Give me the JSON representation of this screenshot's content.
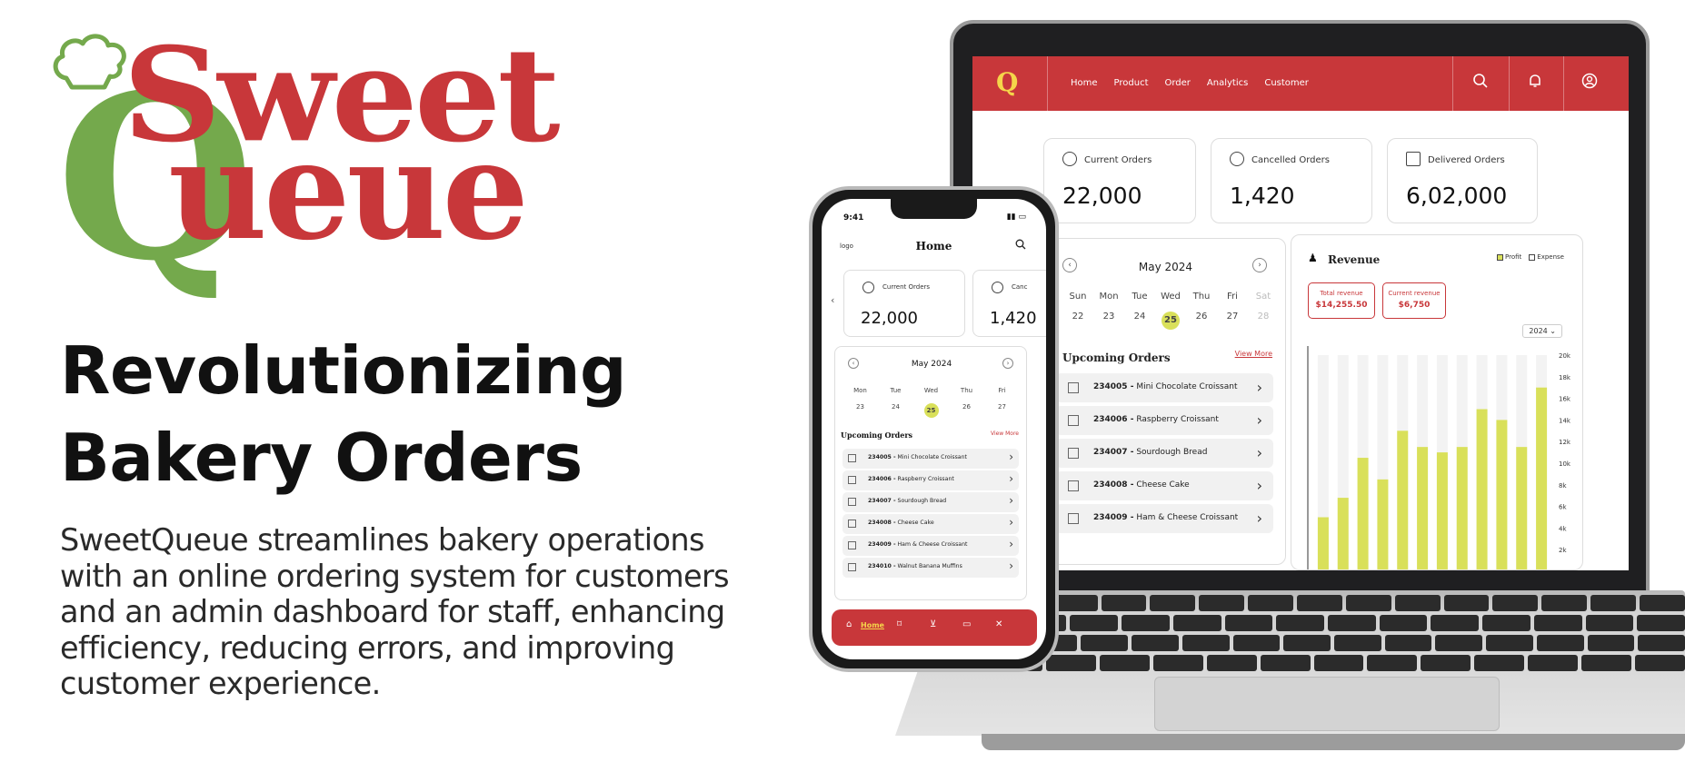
{
  "brand": {
    "name_line1": "Sweet",
    "name_line2": "ueue",
    "big_q": "Q",
    "colors": {
      "red": "#c8373a",
      "green": "#74a94c",
      "yellow": "#d9e05a"
    }
  },
  "hero": {
    "headline_1": "Revolutionizing",
    "headline_2": "Bakery Orders",
    "description": "SweetQueue streamlines bakery operations with an online ordering system for customers and an admin dashboard for staff, enhancing efficiency, reducing errors, and improving customer experience."
  },
  "laptop": {
    "nav": {
      "logo": "Q",
      "links": [
        "Home",
        "Product",
        "Order",
        "Analytics",
        "Customer"
      ],
      "icons": [
        "search-icon",
        "bell-icon",
        "user-icon"
      ]
    },
    "cards": [
      {
        "label": "Current Orders",
        "value": "22,000",
        "icon": "clock-icon"
      },
      {
        "label": "Cancelled Orders",
        "value": "1,420",
        "icon": "cancel-icon"
      },
      {
        "label": "Delivered Orders",
        "value": "6,02,000",
        "icon": "receipt-icon"
      }
    ],
    "calendar": {
      "month": "May 2024",
      "days": [
        "Sun",
        "Mon",
        "Tue",
        "Wed",
        "Thu",
        "Fri",
        "Sat"
      ],
      "dates": [
        "22",
        "23",
        "24",
        "25",
        "26",
        "27",
        "28"
      ],
      "selected": "25"
    },
    "upcoming": {
      "title": "Upcoming Orders",
      "view_more": "View More",
      "orders": [
        {
          "id": "234005 -",
          "item": "Mini Chocolate Croissant"
        },
        {
          "id": "234006 -",
          "item": "Raspberry Croissant"
        },
        {
          "id": "234007 -",
          "item": "Sourdough Bread"
        },
        {
          "id": "234008 -",
          "item": "Cheese Cake"
        },
        {
          "id": "234009 -",
          "item": "Ham & Cheese Croissant"
        }
      ]
    },
    "revenue": {
      "title": "Revenue",
      "legend_profit": "Profit",
      "legend_expense": "Expense",
      "total_label": "Total revenue",
      "total_value": "$14,255.50",
      "current_label": "Current revenue",
      "current_value": "$6,750",
      "year": "2024"
    }
  },
  "phone": {
    "time": "9:41",
    "logo": "logo",
    "title": "Home",
    "cards": [
      {
        "label": "Current Orders",
        "value": "22,000"
      },
      {
        "label": "Canc",
        "value": "1,420"
      }
    ],
    "calendar": {
      "month": "May 2024",
      "days": [
        "Mon",
        "Tue",
        "Wed",
        "Thu",
        "Fri"
      ],
      "dates": [
        "23",
        "24",
        "25",
        "26",
        "27"
      ],
      "selected": "25"
    },
    "upcoming": {
      "title": "Upcoming Orders",
      "view_more": "View More",
      "orders": [
        {
          "id": "234005 -",
          "item": "Mini Chocolate Croissant"
        },
        {
          "id": "234006 -",
          "item": "Raspberry Croissant"
        },
        {
          "id": "234007 -",
          "item": "Sourdough Bread"
        },
        {
          "id": "234008 -",
          "item": "Cheese Cake"
        },
        {
          "id": "234009 -",
          "item": "Ham & Cheese Croissant"
        },
        {
          "id": "234010 -",
          "item": "Walnut Banana Muffins"
        }
      ]
    },
    "tabbar": {
      "home_label": "Home"
    }
  },
  "chart_data": {
    "type": "bar",
    "title": "Revenue",
    "ylim": [
      0,
      20000
    ],
    "y_ticks": [
      "20k",
      "18k",
      "16k",
      "14k",
      "12k",
      "10k",
      "8k",
      "6k",
      "4k",
      "2k"
    ],
    "series": [
      {
        "name": "Profit",
        "values": [
          5000,
          6800,
          10500,
          8500,
          13000,
          11500,
          11000,
          11500,
          15000,
          14000,
          11500,
          17000
        ]
      }
    ]
  }
}
